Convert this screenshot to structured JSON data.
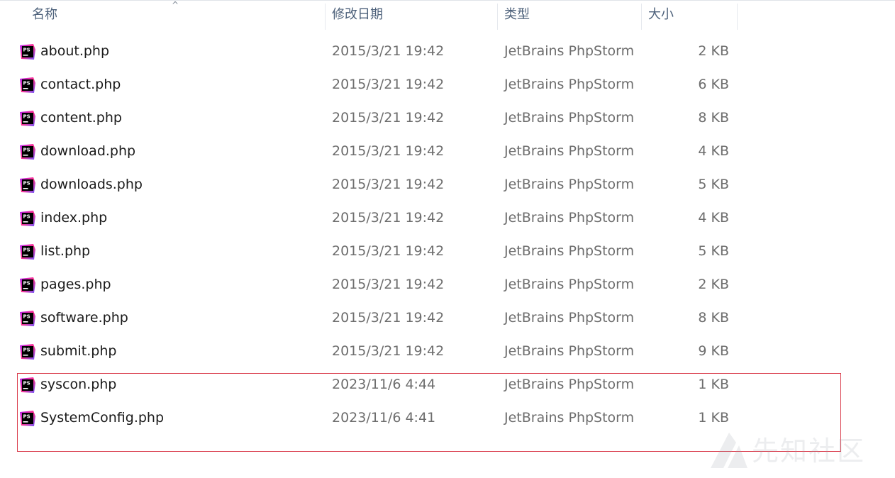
{
  "columns": {
    "name": "名称",
    "modified": "修改日期",
    "type": "类型",
    "size": "大小"
  },
  "sort": {
    "column": "name",
    "direction": "ascending"
  },
  "files": [
    {
      "name": "about.php",
      "modified": "2015/3/21 19:42",
      "type": "JetBrains PhpStorm",
      "size": "2 KB"
    },
    {
      "name": "contact.php",
      "modified": "2015/3/21 19:42",
      "type": "JetBrains PhpStorm",
      "size": "6 KB"
    },
    {
      "name": "content.php",
      "modified": "2015/3/21 19:42",
      "type": "JetBrains PhpStorm",
      "size": "8 KB"
    },
    {
      "name": "download.php",
      "modified": "2015/3/21 19:42",
      "type": "JetBrains PhpStorm",
      "size": "4 KB"
    },
    {
      "name": "downloads.php",
      "modified": "2015/3/21 19:42",
      "type": "JetBrains PhpStorm",
      "size": "5 KB"
    },
    {
      "name": "index.php",
      "modified": "2015/3/21 19:42",
      "type": "JetBrains PhpStorm",
      "size": "4 KB"
    },
    {
      "name": "list.php",
      "modified": "2015/3/21 19:42",
      "type": "JetBrains PhpStorm",
      "size": "5 KB"
    },
    {
      "name": "pages.php",
      "modified": "2015/3/21 19:42",
      "type": "JetBrains PhpStorm",
      "size": "2 KB"
    },
    {
      "name": "software.php",
      "modified": "2015/3/21 19:42",
      "type": "JetBrains PhpStorm",
      "size": "8 KB"
    },
    {
      "name": "submit.php",
      "modified": "2015/3/21 19:42",
      "type": "JetBrains PhpStorm",
      "size": "9 KB"
    },
    {
      "name": "syscon.php",
      "modified": "2023/11/6 4:44",
      "type": "JetBrains PhpStorm",
      "size": "1 KB"
    },
    {
      "name": "SystemConfig.php",
      "modified": "2023/11/6 4:41",
      "type": "JetBrains PhpStorm",
      "size": "1 KB"
    }
  ],
  "file_icon": "phpstorm-file-icon",
  "highlight_color": "#d93a4a",
  "watermark": {
    "text": "先知社区"
  }
}
